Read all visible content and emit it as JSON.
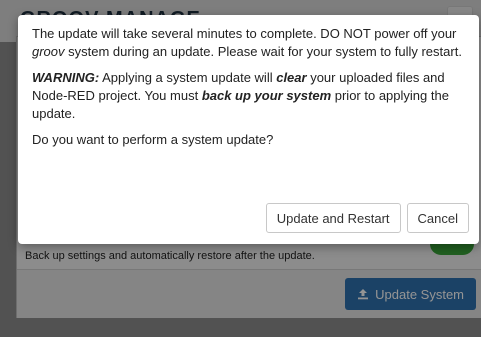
{
  "app": {
    "title": "GROOV MANAGE",
    "backup_description": "Back up settings and automatically restore after the update.",
    "update_system_label": "Update System",
    "update_icon": "upload-icon"
  },
  "modal": {
    "p1_a": "The update will take several minutes to complete. DO NOT power off your ",
    "p1_b": "groov",
    "p1_c": " system during an update. Please wait for your system to fully restart.",
    "p2_a": "WARNING:",
    "p2_b": " Applying a system update will ",
    "p2_c": "clear",
    "p2_d": " your uploaded files and Node-RED project. You must ",
    "p2_e": "back up your system",
    "p2_f": " prior to applying the update.",
    "question": "Do you want to perform a system update?",
    "confirm_label": "Update and Restart",
    "cancel_label": "Cancel"
  },
  "colors": {
    "primary": "#2f73b0",
    "toggle_on": "#3aa63a",
    "overlay": "rgba(0,0,0,0.42)"
  }
}
